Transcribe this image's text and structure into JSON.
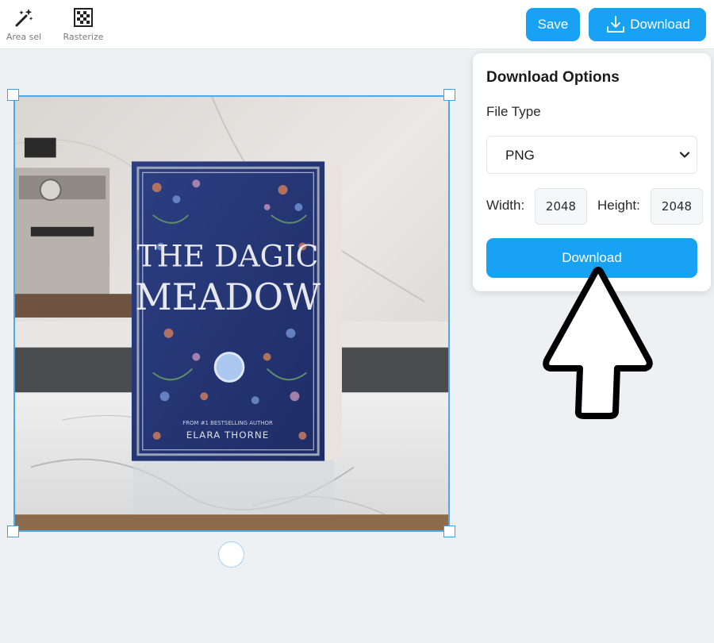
{
  "toolbar": {
    "tools": [
      {
        "label": "Area sel",
        "icon": "magic-wand-icon"
      },
      {
        "label": "Rasterize",
        "icon": "rasterize-grid-icon"
      }
    ],
    "save_label": "Save",
    "download_label": "Download",
    "accent_color": "#17a2f3"
  },
  "canvas": {
    "cover_title_line1": "THE DAGIC",
    "cover_title_line2": "MEADOW",
    "cover_tagline": "FROM #1 BESTSELLING AUTHOR",
    "cover_author": "ELARA THORNE"
  },
  "panel": {
    "title": "Download Options",
    "file_type_label": "File Type",
    "file_type_value": "PNG",
    "width_label": "Width:",
    "width_value": "2048",
    "height_label": "Height:",
    "height_value": "2048",
    "download_button_label": "Download"
  }
}
